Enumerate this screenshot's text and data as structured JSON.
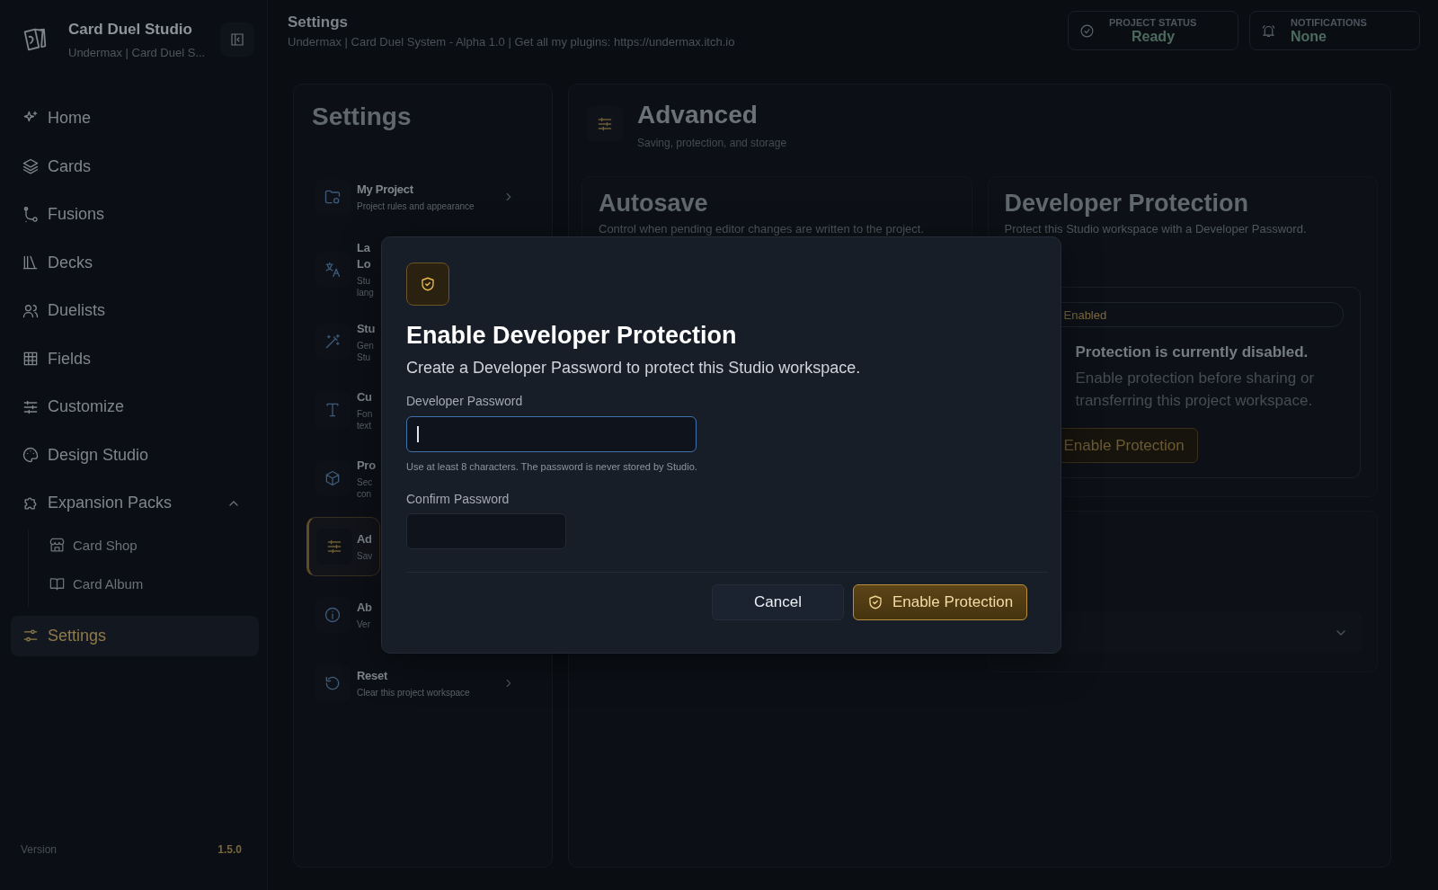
{
  "sidebar": {
    "app_name": "Card Duel Studio",
    "subtitle": "Undermax | Card Duel S...",
    "items": [
      {
        "label": "Home",
        "selected": false
      },
      {
        "label": "Cards",
        "selected": false
      },
      {
        "label": "Fusions",
        "selected": false
      },
      {
        "label": "Decks",
        "selected": false
      },
      {
        "label": "Duelists",
        "selected": false
      },
      {
        "label": "Fields",
        "selected": false
      },
      {
        "label": "Customize",
        "selected": false
      },
      {
        "label": "Design Studio",
        "selected": false
      },
      {
        "label": "Expansion Packs",
        "selected": false,
        "expanded": true,
        "children": [
          {
            "label": "Card Shop",
            "selected": false
          },
          {
            "label": "Card Album",
            "selected": false
          }
        ]
      },
      {
        "label": "Settings",
        "selected": true
      }
    ],
    "version_label": "Version",
    "version": "1.5.0"
  },
  "header": {
    "title": "Settings",
    "subtitle": "Undermax | Card Duel System - Alpha 1.0 | Get all my plugins: https://undermax.itch.io",
    "status_cards": [
      {
        "label": "PROJECT STATUS",
        "value": "Ready"
      },
      {
        "label": "NOTIFICATIONS",
        "value": "None"
      }
    ]
  },
  "settings_nav": {
    "title": "Settings",
    "items": [
      {
        "title": [
          "My Project"
        ],
        "desc": [
          "Project rules and appearance"
        ],
        "selected": false,
        "chevron": true
      },
      {
        "title": [
          "La",
          "Lo"
        ],
        "desc": [
          "Stu",
          "lang"
        ],
        "selected": false,
        "chevron": false
      },
      {
        "title": [
          "Stu"
        ],
        "desc": [
          "Gen",
          "Stu"
        ],
        "selected": false,
        "chevron": false
      },
      {
        "title": [
          "Cu"
        ],
        "desc": [
          "Fon",
          "text"
        ],
        "selected": false,
        "chevron": false
      },
      {
        "title": [
          "Pro"
        ],
        "desc": [
          "Sec",
          "con"
        ],
        "selected": false,
        "chevron": false
      },
      {
        "title": [
          "Ad"
        ],
        "desc": [
          "Sav"
        ],
        "selected": true,
        "chevron": false
      },
      {
        "title": [
          "Ab"
        ],
        "desc": [
          "Ver"
        ],
        "selected": false,
        "chevron": false
      },
      {
        "title": [
          "Reset"
        ],
        "desc": [
          "Clear this project workspace"
        ],
        "selected": false,
        "chevron": true
      }
    ]
  },
  "panel": {
    "title": "Advanced",
    "subtitle": "Saving, protection, and storage",
    "autosave": {
      "title": "Autosave",
      "description": "Control when pending editor changes are written to the project."
    },
    "protection": {
      "title": "Developer Protection",
      "description": "Protect this Studio workspace with a Developer Password.",
      "status": "Enabled",
      "heading": "Protection is currently disabled.",
      "text": "Enable protection before sharing or transferring this project workspace.",
      "button": "Enable Protection"
    }
  },
  "dialog": {
    "title": "Enable Developer Protection",
    "description": "Create a Developer Password to protect this Studio workspace.",
    "fields": [
      {
        "label": "Developer Password",
        "focused": true,
        "hint": "Use at least 8 characters. The password is never stored by Studio."
      },
      {
        "label": "Confirm Password",
        "focused": false
      }
    ],
    "buttons": [
      {
        "label": "Cancel",
        "kind": "secondary"
      },
      {
        "label": "Enable Protection",
        "kind": "primary"
      }
    ]
  }
}
